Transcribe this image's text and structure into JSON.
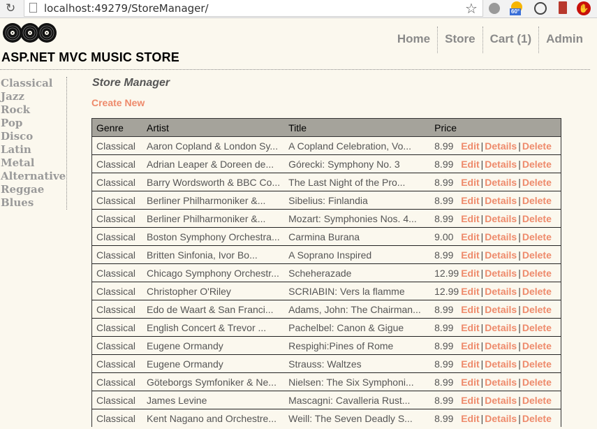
{
  "browser": {
    "url": "localhost:49279/StoreManager/",
    "weather_temp": "60°"
  },
  "header": {
    "site_title": "ASP.NET MVC MUSIC STORE",
    "nav": [
      "Home",
      "Store",
      "Cart (1)",
      "Admin"
    ]
  },
  "sidebar": {
    "genres": [
      "Classical",
      "Jazz",
      "Rock",
      "Pop",
      "Disco",
      "Latin",
      "Metal",
      "Alternative",
      "Reggae",
      "Blues"
    ]
  },
  "main": {
    "heading": "Store Manager",
    "create_new": "Create New",
    "columns": [
      "Genre",
      "Artist",
      "Title",
      "Price",
      ""
    ],
    "actions": {
      "edit": "Edit",
      "details": "Details",
      "delete": "Delete",
      "separator": "|"
    },
    "rows": [
      {
        "genre": "Classical",
        "artist": "Aaron Copland & London Sy...",
        "title": "A Copland Celebration, Vo...",
        "price": "8.99"
      },
      {
        "genre": "Classical",
        "artist": "Adrian Leaper & Doreen de...",
        "title": "Górecki: Symphony No. 3",
        "price": "8.99"
      },
      {
        "genre": "Classical",
        "artist": "Barry Wordsworth & BBC Co...",
        "title": "The Last Night of the Pro...",
        "price": "8.99"
      },
      {
        "genre": "Classical",
        "artist": "Berliner Philharmoniker &...",
        "title": "Sibelius: Finlandia",
        "price": "8.99"
      },
      {
        "genre": "Classical",
        "artist": "Berliner Philharmoniker &...",
        "title": "Mozart: Symphonies Nos. 4...",
        "price": "8.99"
      },
      {
        "genre": "Classical",
        "artist": "Boston Symphony Orchestra...",
        "title": "Carmina Burana",
        "price": "9.00"
      },
      {
        "genre": "Classical",
        "artist": "Britten Sinfonia, Ivor Bo...",
        "title": "A Soprano Inspired",
        "price": "8.99"
      },
      {
        "genre": "Classical",
        "artist": "Chicago Symphony Orchestr...",
        "title": "Scheherazade",
        "price": "12.99"
      },
      {
        "genre": "Classical",
        "artist": "Christopher O'Riley",
        "title": "SCRIABIN: Vers la flamme",
        "price": "12.99"
      },
      {
        "genre": "Classical",
        "artist": "Edo de Waart & San Franci...",
        "title": "Adams, John: The Chairman...",
        "price": "8.99"
      },
      {
        "genre": "Classical",
        "artist": "English Concert & Trevor ...",
        "title": "Pachelbel: Canon & Gigue",
        "price": "8.99"
      },
      {
        "genre": "Classical",
        "artist": "Eugene Ormandy",
        "title": "Respighi:Pines of Rome",
        "price": "8.99"
      },
      {
        "genre": "Classical",
        "artist": "Eugene Ormandy",
        "title": "Strauss: Waltzes",
        "price": "8.99"
      },
      {
        "genre": "Classical",
        "artist": "Göteborgs Symfoniker & Ne...",
        "title": "Nielsen: The Six Symphoni...",
        "price": "8.99"
      },
      {
        "genre": "Classical",
        "artist": "James Levine",
        "title": "Mascagni: Cavalleria Rust...",
        "price": "8.99"
      },
      {
        "genre": "Classical",
        "artist": "Kent Nagano and Orchestre...",
        "title": "Weill: The Seven Deadly S...",
        "price": "8.99"
      }
    ]
  }
}
